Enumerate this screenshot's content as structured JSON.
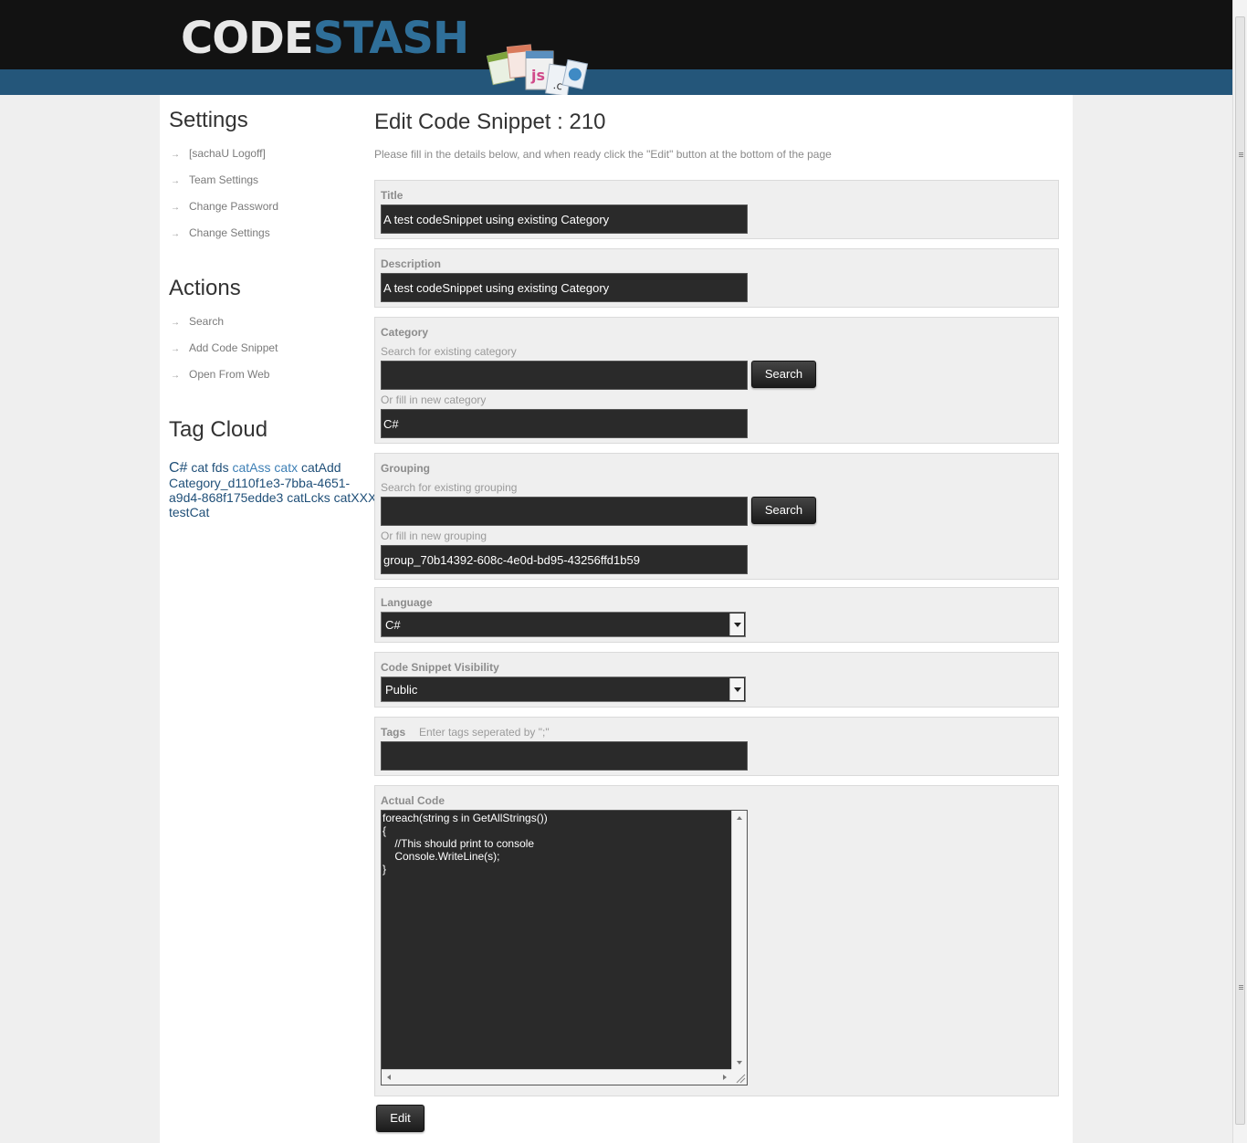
{
  "header": {
    "logo_code": "CODE",
    "logo_stash": "STASH"
  },
  "sidebar": {
    "settings_heading": "Settings",
    "settings_items": [
      "[sachaU Logoff]",
      "Team Settings",
      "Change Password",
      "Change Settings"
    ],
    "actions_heading": "Actions",
    "actions_items": [
      "Search",
      "Add Code Snippet",
      "Open From Web"
    ],
    "tag_cloud_heading": "Tag Cloud",
    "tags": [
      "C#",
      "cat",
      "fds",
      "catAss",
      "catx",
      "catAdd",
      "Category_d110f1e3-7bba-4651-a9d4-868f175edde3",
      "catLcks",
      "catXXX",
      "testCat"
    ]
  },
  "main": {
    "title": "Edit Code Snippet : 210",
    "intro": "Please fill in the details below, and when ready click the \"Edit\" button at the bottom of the page",
    "title_field": {
      "label": "Title",
      "value": "A test codeSnippet using existing Category"
    },
    "description_field": {
      "label": "Description",
      "value": "A test codeSnippet using existing Category"
    },
    "category": {
      "label": "Category",
      "search_hint": "Search for existing category",
      "search_value": "",
      "search_button": "Search",
      "new_hint": "Or fill in new category",
      "new_value": "C#"
    },
    "grouping": {
      "label": "Grouping",
      "search_hint": "Search for existing grouping",
      "search_value": "",
      "search_button": "Search",
      "new_hint": "Or fill in new grouping",
      "new_value": "group_70b14392-608c-4e0d-bd95-43256ffd1b59"
    },
    "language": {
      "label": "Language",
      "selected": "C#"
    },
    "visibility": {
      "label": "Code Snippet Visibility",
      "selected": "Public"
    },
    "tags_field": {
      "label": "Tags",
      "hint": "Enter tags seperated by \";\"",
      "value": ""
    },
    "actual_code": {
      "label": "Actual Code",
      "code": "foreach(string s in GetAllStrings())\n{\n    //This should print to console\n    Console.WriteLine(s);\n}"
    },
    "edit_button": "Edit"
  }
}
